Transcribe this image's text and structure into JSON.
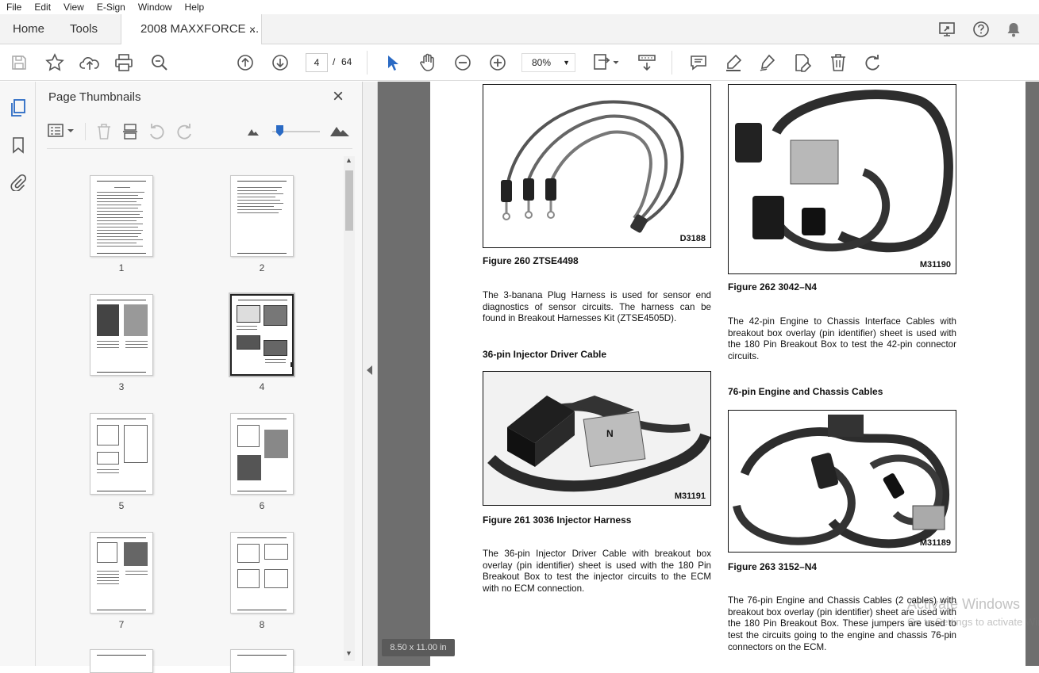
{
  "menu": [
    "File",
    "Edit",
    "View",
    "E-Sign",
    "Window",
    "Help"
  ],
  "tabs": {
    "home": "Home",
    "tools": "Tools",
    "doc": "2008 MAXXFORCE ...",
    "close": "×"
  },
  "toolbar": {
    "page_current": "4",
    "page_sep": "/",
    "page_total": "64",
    "zoom": "80%"
  },
  "panel": {
    "title": "Page Thumbnails",
    "close": "×"
  },
  "thumbnails": [
    "1",
    "2",
    "3",
    "4",
    "5",
    "6",
    "7",
    "8"
  ],
  "status": {
    "page_size": "8.50 x 11.00 in"
  },
  "watermark": {
    "line1": "Activate Windows",
    "line2": "Go to Settings to activate Windows."
  },
  "doc": {
    "fig260": {
      "id": "D3188",
      "caption": "Figure 260    ZTSE4498"
    },
    "p1": "The 3-banana Plug Harness is used for sensor end diagnostics of sensor circuits.  The harness can be found in Breakout Harnesses Kit (ZTSE4505D).",
    "h1": "36-pin Injector Driver Cable",
    "fig261": {
      "id": "M31191",
      "caption": "Figure 261    3036 Injector Harness"
    },
    "p2": "The 36-pin Injector Driver Cable with breakout box overlay (pin identifier) sheet is used with the 180 Pin Breakout Box to test the injector circuits to the ECM with no ECM connection.",
    "fig262": {
      "id": "M31190",
      "caption": "Figure 262    3042–N4"
    },
    "p3": "The 42-pin Engine to Chassis Interface Cables with breakout box overlay (pin identifier) sheet is used with the 180 Pin Breakout Box to test the 42-pin connector circuits.",
    "h2": "76-pin Engine and Chassis Cables",
    "fig263": {
      "id": "M31189",
      "caption": "Figure 263    3152–N4"
    },
    "p4": "The 76-pin Engine and Chassis Cables (2 cables) with breakout box overlay (pin identifier) sheet are used with the 180 Pin Breakout Box.  These jumpers are used to test the circuits going to the engine and chassis 76-pin connectors on the ECM."
  }
}
